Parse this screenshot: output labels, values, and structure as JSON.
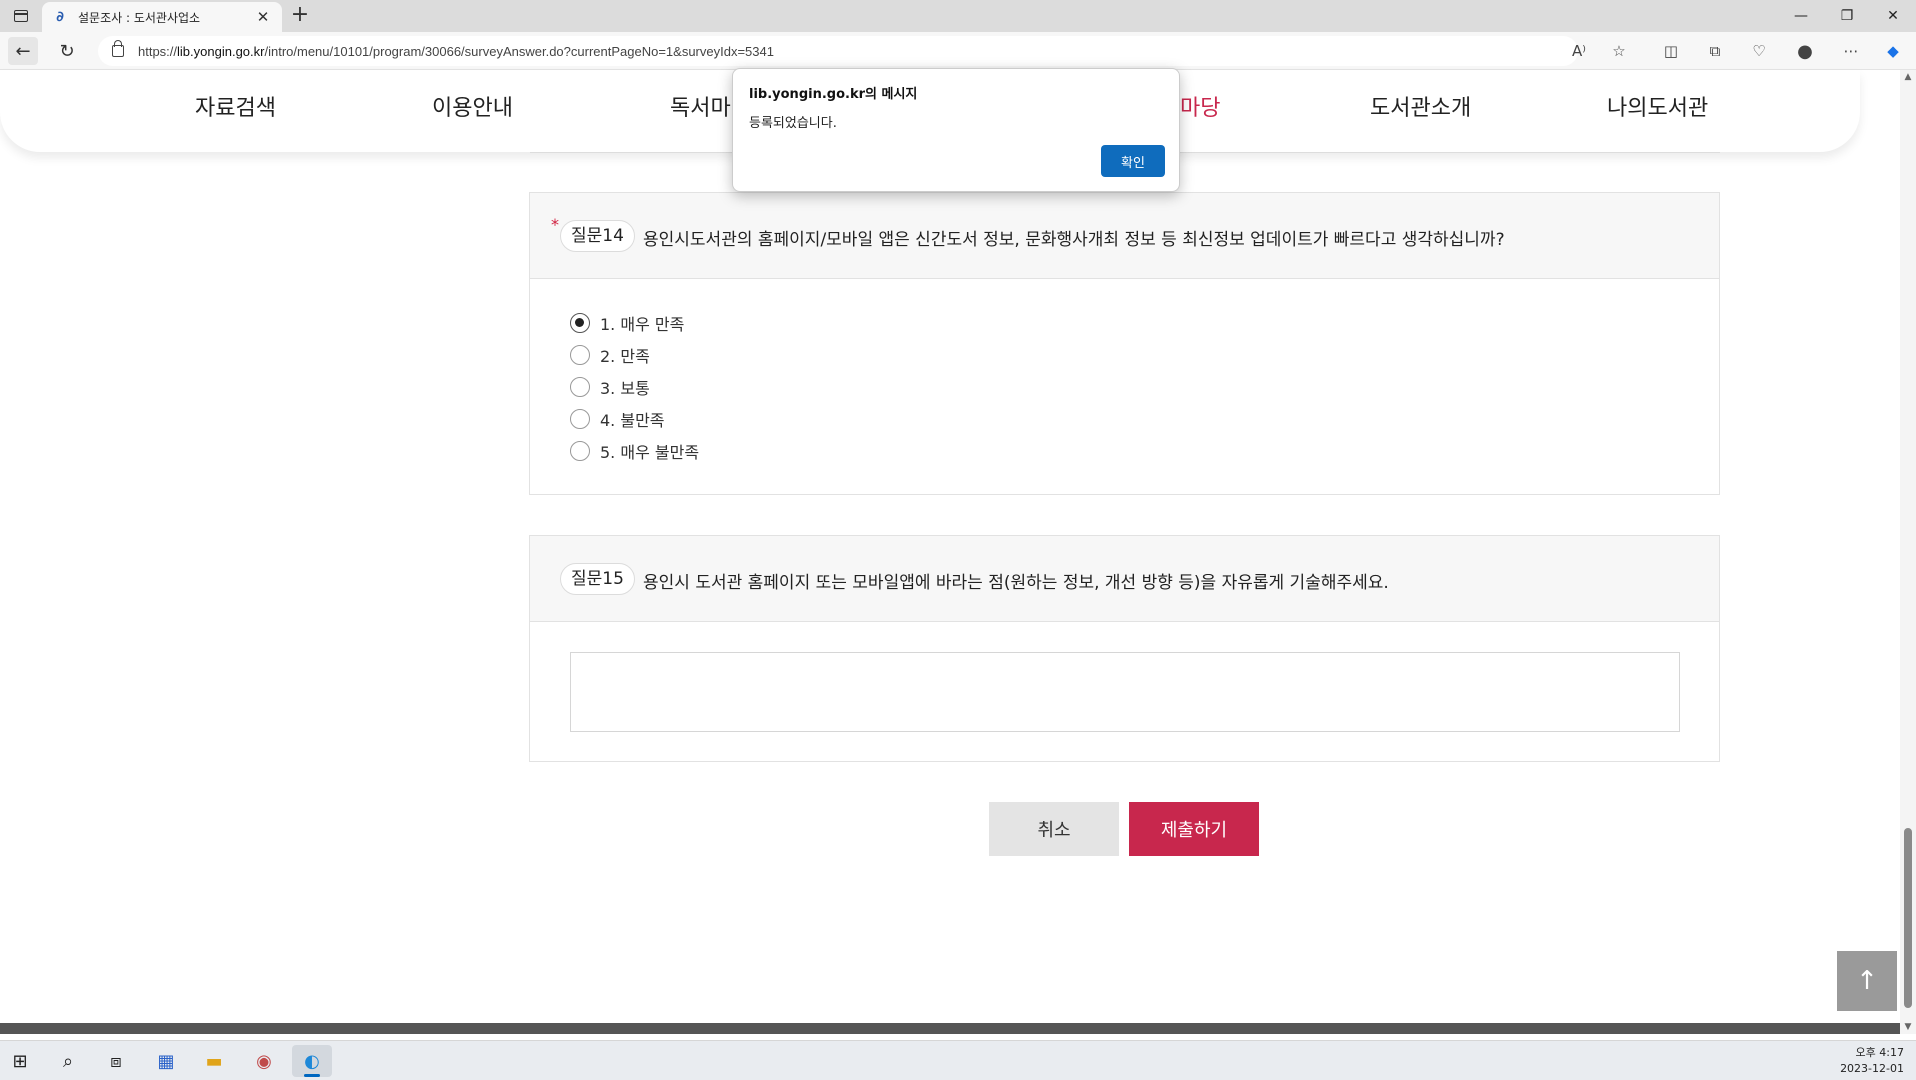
{
  "browser": {
    "tab_title": "설문조사 : 도서관사업소",
    "url_prefix": "https://",
    "url_host": "lib.yongin.go.kr",
    "url_path": "/intro/menu/10101/program/30066/surveyAnswer.do?currentPageNo=1&surveyIdx=5341"
  },
  "site_nav": {
    "items": [
      "자료검색",
      "이용안내",
      "독서마",
      "마당",
      "도서관소개",
      "나의도서관"
    ],
    "active_index": 3,
    "active_color": "#c8274d"
  },
  "questions": [
    {
      "number": "질문14",
      "required": "*",
      "text": "용인시도서관의 홈페이지/모바일 앱은 신간도서 정보, 문화행사개최 정보 등 최신정보 업데이트가 빠르다고 생각하십니까?",
      "options": [
        "1. 매우 만족",
        "2. 만족",
        "3. 보통",
        "4. 불만족",
        "5. 매우 불만족"
      ],
      "selected_index": 0
    },
    {
      "number": "질문15",
      "text": "용인시 도서관 홈페이지 또는 모바일앱에 바라는 점(원하는 정보, 개선 방향 등)을 자유롭게 기술해주세요.",
      "answer": ""
    }
  ],
  "buttons": {
    "cancel": "취소",
    "submit": "제출하기"
  },
  "dialog": {
    "title": "lib.yongin.go.kr의 메시지",
    "message": "등록되었습니다.",
    "ok": "확인",
    "ok_color": "#0f6cbd"
  },
  "taskbar": {
    "time": "오후 4:17",
    "date": "2023-12-01"
  }
}
